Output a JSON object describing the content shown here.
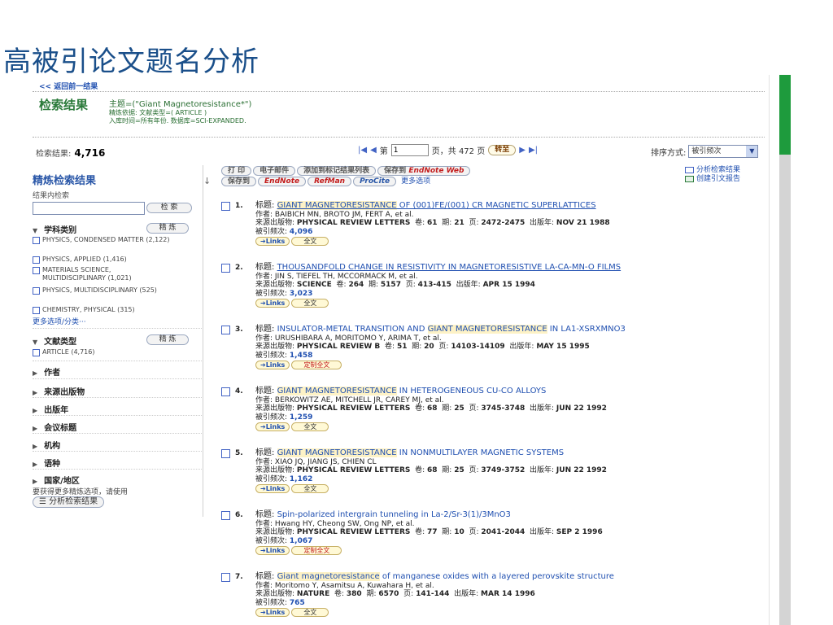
{
  "slide": {
    "title": "高被引论文题名分析"
  },
  "header": {
    "back_link": "<< 返回前一结果",
    "results_heading": "检索结果",
    "query": "主题=(\"Giant Magnetoresistance*\")",
    "refine_basis": "精炼依据: 文献类型=( ARTICLE )",
    "timespan": "入库时间=所有年份. 数据库=SCI-EXPANDED."
  },
  "summary": {
    "count_label": "检索结果:",
    "count_value": "4,716",
    "page_prefix": "第",
    "page_value": "1",
    "page_suffix": "页，共 472 页",
    "go_button": "转至",
    "sort_label": "排序方式:",
    "sort_value": "被引频次"
  },
  "sidebar": {
    "title": "精炼检索结果",
    "within_label": "结果内检索",
    "search_button": "检 索",
    "refine_button": "精 炼",
    "subject_section": "学科类别",
    "subjects": [
      "PHYSICS, CONDENSED MATTER (2,122)",
      "PHYSICS, APPLIED (1,416)",
      "MATERIALS SCIENCE, MULTIDISCIPLINARY (1,021)",
      "PHYSICS, MULTIDISCIPLINARY (525)",
      "CHEMISTRY, PHYSICAL (315)"
    ],
    "more_options": "更多选项/分类···",
    "doctype_section": "文献类型",
    "doctypes": [
      "ARTICLE (4,716)"
    ],
    "collapsed_sections": [
      "作者",
      "来源出版物",
      "出版年",
      "会议标题",
      "机构",
      "语种",
      "国家/地区"
    ],
    "note": "要获得更多精炼选项，请使用",
    "analyze_button": "分析检索结果"
  },
  "toolbar": {
    "row1": [
      "打 印",
      "电子邮件",
      "添加到标记结果列表",
      "保存到"
    ],
    "endnote_web": "EndNote Web",
    "save_to": "保存到",
    "endnote": "EndNote",
    "refman": "RefMan",
    "procite": "ProCite",
    "more_options": "更多选项",
    "analyze_results": "分析检索结果",
    "citation_report": "创建引文报告"
  },
  "labels": {
    "title": "标题:",
    "authors": "作者:",
    "source": "来源出版物:",
    "volume": "卷:",
    "issue": "期:",
    "pages": "页:",
    "published": "出版年:",
    "cited": "被引频次:",
    "links": "Links",
    "fulltext": "全文",
    "custom_fulltext": "定制全文"
  },
  "records": [
    {
      "num": "1.",
      "title_parts": [
        "GIANT MAGNETORESISTANCE",
        " OF (001)FE/(001) CR MAGNETIC SUPERLATTICES"
      ],
      "authors": "BAIBICH MN, BROTO JM, FERT A, et al.",
      "source": "PHYSICAL REVIEW LETTERS",
      "volume": "61",
      "issue": "21",
      "pages": "2472-2475",
      "date": "NOV 21 1988",
      "cites": "4,096",
      "fulltext": "全文"
    },
    {
      "num": "2.",
      "title_parts": [
        "",
        "THOUSANDFOLD CHANGE IN RESISTIVITY IN MAGNETORESISTIVE LA-CA-MN-O FILMS"
      ],
      "authors": "JIN S, TIEFEL TH, MCCORMACK M, et al.",
      "source": "SCIENCE",
      "volume": "264",
      "issue": "5157",
      "pages": "413-415",
      "date": "APR 15 1994",
      "cites": "3,023",
      "fulltext": "全文"
    },
    {
      "num": "3.",
      "title_parts": [
        "INSULATOR-METAL TRANSITION AND ",
        "GIANT MAGNETORESISTANCE",
        " IN LA1-XSRXMNO3"
      ],
      "authors": "URUSHIBARA A, MORITOMO Y, ARIMA T, et al.",
      "source": "PHYSICAL REVIEW B",
      "volume": "51",
      "issue": "20",
      "pages": "14103-14109",
      "date": "MAY 15 1995",
      "cites": "1,458",
      "fulltext": "定制全文"
    },
    {
      "num": "4.",
      "title_parts": [
        "GIANT MAGNETORESISTANCE",
        " IN HETEROGENEOUS CU-CO ALLOYS"
      ],
      "authors": "BERKOWITZ AE, MITCHELL JR, CAREY MJ, et al.",
      "source": "PHYSICAL REVIEW LETTERS",
      "volume": "68",
      "issue": "25",
      "pages": "3745-3748",
      "date": "JUN 22 1992",
      "cites": "1,259",
      "fulltext": "全文"
    },
    {
      "num": "5.",
      "title_parts": [
        "GIANT MAGNETORESISTANCE",
        " IN NONMULTILAYER MAGNETIC SYSTEMS"
      ],
      "authors": "XIAO JQ, JIANG JS, CHIEN CL",
      "source": "PHYSICAL REVIEW LETTERS",
      "volume": "68",
      "issue": "25",
      "pages": "3749-3752",
      "date": "JUN 22 1992",
      "cites": "1,162",
      "fulltext": "全文"
    },
    {
      "num": "6.",
      "title_parts": [
        "",
        "Spin-polarized intergrain tunneling in La-2/Sr-3(1)/3MnO3"
      ],
      "authors": "Hwang HY, Cheong SW, Ong NP, et al.",
      "source": "PHYSICAL REVIEW LETTERS",
      "volume": "77",
      "issue": "10",
      "pages": "2041-2044",
      "date": "SEP 2 1996",
      "cites": "1,067",
      "fulltext": "定制全文"
    },
    {
      "num": "7.",
      "title_parts": [
        "Giant magnetoresistance",
        " of manganese oxides with a layered perovskite structure"
      ],
      "authors": "Moritomo Y, Asamitsu A, Kuwahara H, et al.",
      "source": "NATURE",
      "volume": "380",
      "issue": "6570",
      "pages": "141-144",
      "date": "MAR 14 1996",
      "cites": "765",
      "fulltext": "全文"
    }
  ]
}
